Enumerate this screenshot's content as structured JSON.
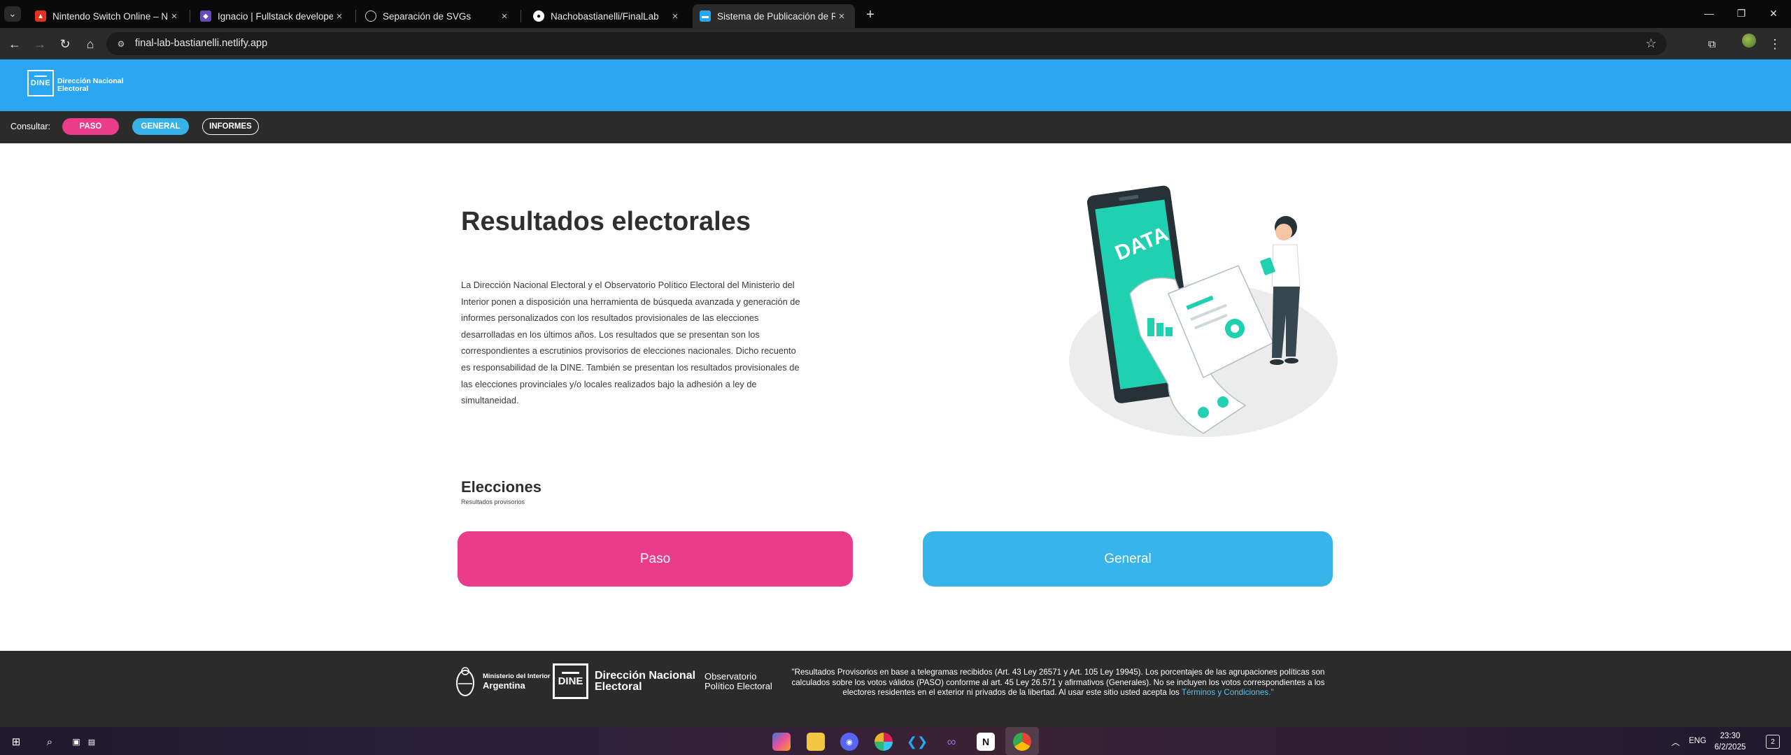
{
  "browser": {
    "tabs": [
      {
        "title": "Nintendo Switch Online – Ninte",
        "favicon": "mario-icon",
        "color": "#e5311f",
        "active": false
      },
      {
        "title": "Ignacio | Fullstack developer | F",
        "favicon": "portfolio-icon",
        "color": "#6a4bb5",
        "active": false
      },
      {
        "title": "Separación de SVGs",
        "favicon": "globe-icon",
        "color": "#cfcfcf",
        "active": false
      },
      {
        "title": "Nachobastianelli/FinalLab",
        "favicon": "github-icon",
        "color": "#ffffff",
        "active": false
      },
      {
        "title": "Sistema de Publicación de Resu",
        "favicon": "dine-favicon",
        "color": "#2aa6f2",
        "active": true
      }
    ],
    "url": "final-lab-bastianelli.netlify.app"
  },
  "header": {
    "logo_box": "DINE",
    "logo_line1": "Dirección Nacional",
    "logo_line2": "Electoral"
  },
  "consult": {
    "label": "Consultar:",
    "paso": "PASO",
    "general": "GENERAL",
    "informes": "INFORMES"
  },
  "main": {
    "title": "Resultados electorales",
    "description": "La Dirección Nacional Electoral y el Observatorio Político Electoral del Ministerio del Interior ponen a disposición una herramienta de búsqueda avanzada y generación de informes personalizados con los resultados provisionales de las elecciones desarrolladas en los últimos años. Los resultados que se presentan son los correspondientes a escrutinios provisorios de elecciones nacionales. Dicho recuento es responsabilidad de la DINE. También se presentan los resultados provisionales de las elecciones provinciales y/o locales realizados bajo la adhesión a ley de simultaneidad.",
    "illustration_label": "DATA"
  },
  "elecciones": {
    "title": "Elecciones",
    "subtitle": "Resultados provisorios",
    "paso_button": "Paso",
    "general_button": "General"
  },
  "footer": {
    "ministerio_line1": "Ministerio del Interior",
    "ministerio_line2": "Argentina",
    "dine_box": "DINE",
    "dine_line1": "Dirección Nacional",
    "dine_line2": "Electoral",
    "observatorio_line1": "Observatorio",
    "observatorio_line2": "Político Electoral",
    "note": "\"Resultados Provisorios en base a telegramas recibidos (Art. 43 Ley 26571 y Art. 105 Ley 19945). Los porcentajes de las agrupaciones políticas son calculados sobre los votos válidos (PASO) conforme al art. 45 Ley 26.571 y afirmativos (Generales). No se incluyen los votos correspondientes a los electores residentes en el exterior ni privados de la libertad. Al usar este sitio usted acepta los",
    "note_link": "Términos y Condiciones.\""
  },
  "taskbar": {
    "language": "ENG",
    "time": "23:30",
    "date": "6/2/2025",
    "notifications": "2"
  },
  "colors": {
    "brand_blue": "#2aa6f2",
    "paso_pink": "#ea3c8b",
    "general_blue": "#37b5ea",
    "dark_bar": "#2b2b2b",
    "illustration_teal": "#1fd1b0"
  }
}
